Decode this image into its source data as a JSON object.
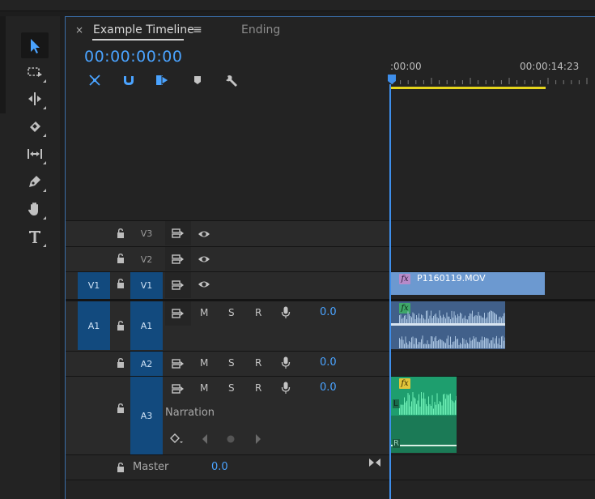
{
  "tabs": {
    "close_glyph": "×",
    "active_title": "Example Timeline",
    "menu_glyph": "≡",
    "inactive_title": "Ending"
  },
  "timecode": "00:00:00:00",
  "ruler": {
    "start_label": ":00:00",
    "end_label": "00:00:14:23"
  },
  "tools": [
    {
      "name": "selection-tool",
      "icon": "arrow-icon"
    },
    {
      "name": "track-select-tool",
      "icon": "track-select-icon"
    },
    {
      "name": "ripple-edit-tool",
      "icon": "ripple-edit-icon"
    },
    {
      "name": "razor-tool",
      "icon": "razor-icon"
    },
    {
      "name": "slip-tool",
      "icon": "slip-icon"
    },
    {
      "name": "pen-tool",
      "icon": "pen-icon"
    },
    {
      "name": "hand-tool",
      "icon": "hand-icon"
    },
    {
      "name": "type-tool",
      "icon": "type-icon"
    }
  ],
  "timeline_tools": [
    "nest-icon",
    "snap-icon",
    "linked-selection-icon",
    "marker-icon",
    "wrench-icon"
  ],
  "tracks": {
    "v3": {
      "target": "V3"
    },
    "v2": {
      "target": "V2"
    },
    "v1": {
      "source": "V1",
      "target": "V1"
    },
    "a1": {
      "source": "A1",
      "target": "A1",
      "mute": "M",
      "solo": "S",
      "record": "R",
      "volume": "0.0"
    },
    "a2": {
      "target": "A2",
      "mute": "M",
      "solo": "S",
      "record": "R",
      "volume": "0.0"
    },
    "a3": {
      "target": "A3",
      "mute": "M",
      "solo": "S",
      "record": "R",
      "volume": "0.0",
      "name": "Narration"
    },
    "master": {
      "label": "Master",
      "volume": "0.0"
    }
  },
  "clips": {
    "video": {
      "name": "P1160119.MOV",
      "fx": "fx"
    },
    "a1_audio": {
      "fx": "fx"
    },
    "a3_audio": {
      "fx": "fx",
      "left": "L",
      "right": "R"
    }
  },
  "colors": {
    "accent_blue": "#4aa3ff",
    "target_blue": "#124a7e",
    "video_clip": "#6c99d0",
    "audio_clip_a1": "#41608a",
    "audio_clip_a3": "#1e9e6e",
    "work_area": "#e5d51d"
  }
}
